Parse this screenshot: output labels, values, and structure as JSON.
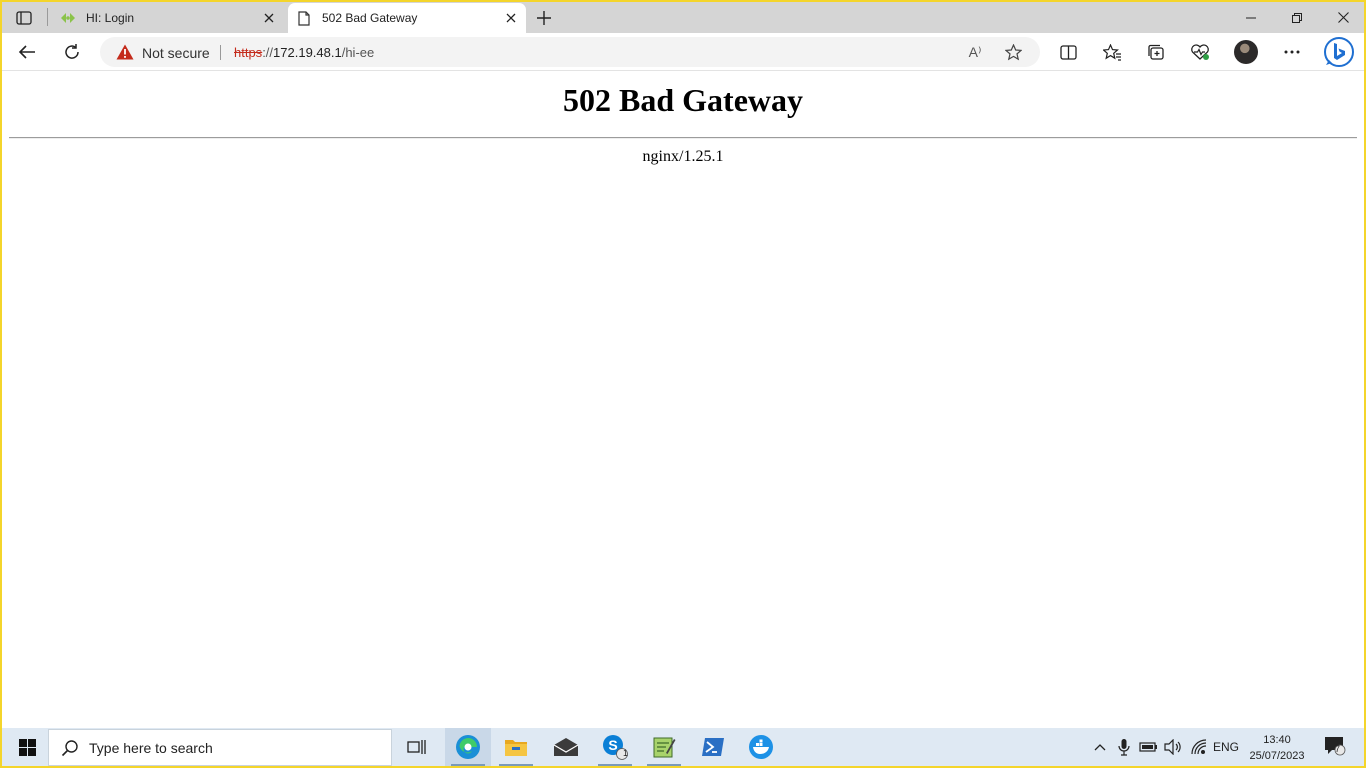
{
  "browser": {
    "tabs": [
      {
        "title": "HI: Login",
        "favicon": "leaf-icon",
        "active": false
      },
      {
        "title": "502 Bad Gateway",
        "favicon": "page-icon",
        "active": true
      }
    ],
    "address": {
      "security_label": "Not secure",
      "url_scheme": "https",
      "url_separator": "://",
      "url_host": "172.19.48.1",
      "url_path": "/hi-ee"
    },
    "read_aloud_label": "A⁾"
  },
  "page": {
    "heading": "502 Bad Gateway",
    "server": "nginx/1.25.1"
  },
  "taskbar": {
    "search_placeholder": "Type here to search",
    "apps": [
      "task-view-icon",
      "edge-icon",
      "file-explorer-icon",
      "mail-icon",
      "skype-icon",
      "notepad-icon",
      "powershell-icon",
      "docker-icon"
    ],
    "skype_badge": "1",
    "language": "ENG",
    "time": "13:40",
    "date": "25/07/2023",
    "notifications_badge": "7"
  },
  "colors": {
    "screen_border": "#f4d52b",
    "tabstrip": "#d5d5d5",
    "taskbar": "#dfe9f3",
    "insecure_red": "#c42b1c"
  }
}
